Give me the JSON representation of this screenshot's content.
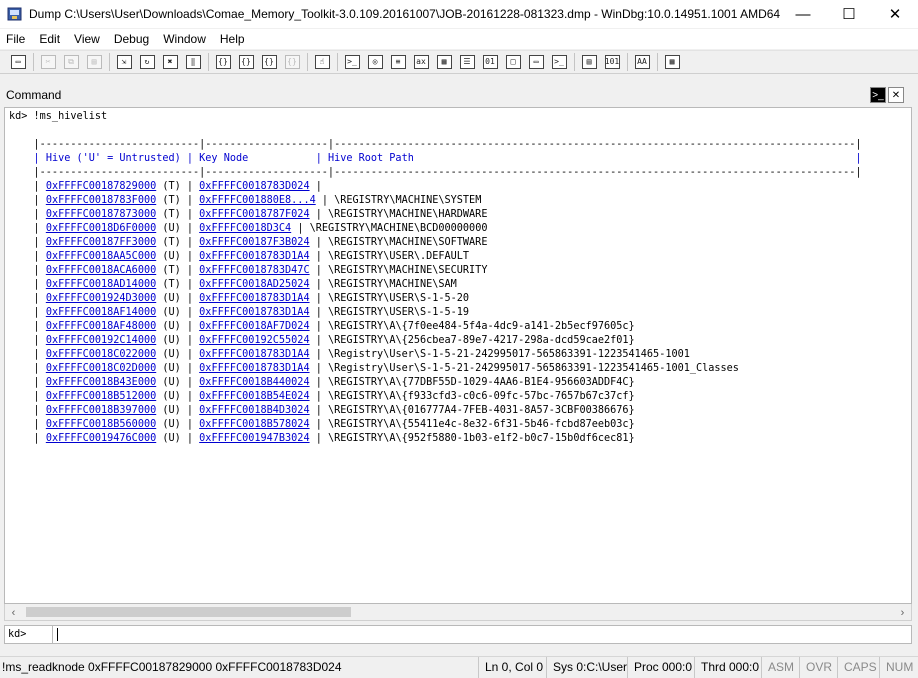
{
  "window": {
    "title": "Dump C:\\Users\\User\\Downloads\\Comae_Memory_Toolkit-3.0.109.20161007\\JOB-20161228-081323.dmp - WinDbg:10.0.14951.1001 AMD64",
    "minimize": "—",
    "maximize": "☐",
    "close": "✕"
  },
  "menu": [
    "File",
    "Edit",
    "View",
    "Debug",
    "Window",
    "Help"
  ],
  "toolbar": {
    "groups": [
      [
        {
          "name": "open-icon",
          "glyph": "▭",
          "enabled": true
        }
      ],
      [
        {
          "name": "cut-icon",
          "glyph": "✂",
          "enabled": false
        },
        {
          "name": "copy-icon",
          "glyph": "⧉",
          "enabled": false
        },
        {
          "name": "paste-icon",
          "glyph": "▤",
          "enabled": false
        }
      ],
      [
        {
          "name": "go-icon",
          "glyph": "⇲",
          "enabled": true
        },
        {
          "name": "restart-icon",
          "glyph": "↻",
          "enabled": true
        },
        {
          "name": "stop-debugging-icon",
          "glyph": "✖",
          "enabled": true
        },
        {
          "name": "break-icon",
          "glyph": "‖",
          "enabled": true
        }
      ],
      [
        {
          "name": "step-into-icon",
          "glyph": "{}",
          "enabled": true
        },
        {
          "name": "step-over-icon",
          "glyph": "{}",
          "enabled": true
        },
        {
          "name": "step-out-icon",
          "glyph": "{}",
          "enabled": true
        },
        {
          "name": "run-to-cursor-icon",
          "glyph": "{}",
          "enabled": false
        }
      ],
      [
        {
          "name": "hand-icon",
          "glyph": "☝",
          "enabled": true
        }
      ],
      [
        {
          "name": "command-window-icon",
          "glyph": ">_",
          "enabled": true
        },
        {
          "name": "watch-window-icon",
          "glyph": "◎",
          "enabled": true
        },
        {
          "name": "locals-window-icon",
          "glyph": "≡",
          "enabled": true
        },
        {
          "name": "registers-window-icon",
          "glyph": "ax",
          "enabled": true
        },
        {
          "name": "memory-window-icon",
          "glyph": "▦",
          "enabled": true
        },
        {
          "name": "call-stack-icon",
          "glyph": "☰",
          "enabled": true
        },
        {
          "name": "disassembly-icon",
          "glyph": "01",
          "enabled": true
        },
        {
          "name": "scratch-pad-icon",
          "glyph": "□",
          "enabled": true
        },
        {
          "name": "processes-threads-icon",
          "glyph": "▭",
          "enabled": true
        },
        {
          "name": "command-browser-icon",
          "glyph": ">_",
          "enabled": true
        }
      ],
      [
        {
          "name": "source-mode-icon",
          "glyph": "▤",
          "enabled": true
        },
        {
          "name": "hex-mode-icon",
          "glyph": "101",
          "enabled": true
        }
      ],
      [
        {
          "name": "font-icon",
          "glyph": "AA",
          "enabled": true
        }
      ],
      [
        {
          "name": "options-icon",
          "glyph": "▦",
          "enabled": true
        }
      ]
    ]
  },
  "command_window": {
    "title": "Command",
    "executed_command": "kd> !ms_hivelist",
    "separator_top": "    |--------------------------|--------------------|-------------------------------------------------------------------------------------|",
    "header": {
      "hive": "| Hive ('U' = Untrusted) ",
      "key_node": "| Key Node           ",
      "path": "| Hive Root Path                                                                        |"
    },
    "separator_mid": "    |--------------------------|--------------------|-------------------------------------------------------------------------------------|",
    "rows": [
      {
        "hive": "0xFFFFC00187829000",
        "flag": "(T)",
        "key": "0xFFFFC0018783D024",
        "path": ""
      },
      {
        "hive": "0xFFFFC0018783F000",
        "flag": "(T)",
        "key": "0xFFFFC001880E8...4",
        "path": "\\REGISTRY\\MACHINE\\SYSTEM"
      },
      {
        "hive": "0xFFFFC00187873000",
        "flag": "(T)",
        "key": "0xFFFFC0018787F024",
        "path": "\\REGISTRY\\MACHINE\\HARDWARE"
      },
      {
        "hive": "0xFFFFC0018D6F0000",
        "flag": "(U)",
        "key": "0xFFFFC0018D3C4",
        "path": "\\REGISTRY\\MACHINE\\BCD00000000"
      },
      {
        "hive": "0xFFFFC00187FF3000",
        "flag": "(T)",
        "key": "0xFFFFC00187F3B024",
        "path": "\\REGISTRY\\MACHINE\\SOFTWARE"
      },
      {
        "hive": "0xFFFFC0018AA5C000",
        "flag": "(U)",
        "key": "0xFFFFC0018783D1A4",
        "path": "\\REGISTRY\\USER\\.DEFAULT"
      },
      {
        "hive": "0xFFFFC0018ACA6000",
        "flag": "(T)",
        "key": "0xFFFFC0018783D47C",
        "path": "\\REGISTRY\\MACHINE\\SECURITY"
      },
      {
        "hive": "0xFFFFC0018AD14000",
        "flag": "(T)",
        "key": "0xFFFFC0018AD25024",
        "path": "\\REGISTRY\\MACHINE\\SAM"
      },
      {
        "hive": "0xFFFFC001924D3000",
        "flag": "(U)",
        "key": "0xFFFFC0018783D1A4",
        "path": "\\REGISTRY\\USER\\S-1-5-20"
      },
      {
        "hive": "0xFFFFC0018AF14000",
        "flag": "(U)",
        "key": "0xFFFFC0018783D1A4",
        "path": "\\REGISTRY\\USER\\S-1-5-19"
      },
      {
        "hive": "0xFFFFC0018AF48000",
        "flag": "(U)",
        "key": "0xFFFFC0018AF7D024",
        "path": "\\REGISTRY\\A\\{7f0ee484-5f4a-4dc9-a141-2b5ecf97605c}"
      },
      {
        "hive": "0xFFFFC00192C14000",
        "flag": "(U)",
        "key": "0xFFFFC00192C55024",
        "path": "\\REGISTRY\\A\\{256cbea7-89e7-4217-298a-dcd59cae2f01}"
      },
      {
        "hive": "0xFFFFC0018C022000",
        "flag": "(U)",
        "key": "0xFFFFC0018783D1A4",
        "path": "\\Registry\\User\\S-1-5-21-242995017-565863391-1223541465-1001"
      },
      {
        "hive": "0xFFFFC0018C02D000",
        "flag": "(U)",
        "key": "0xFFFFC0018783D1A4",
        "path": "\\Registry\\User\\S-1-5-21-242995017-565863391-1223541465-1001_Classes"
      },
      {
        "hive": "0xFFFFC0018B43E000",
        "flag": "(U)",
        "key": "0xFFFFC0018B440024",
        "path": "\\REGISTRY\\A\\{77DBF55D-1029-4AA6-B1E4-956603ADDF4C}"
      },
      {
        "hive": "0xFFFFC0018B512000",
        "flag": "(U)",
        "key": "0xFFFFC0018B54E024",
        "path": "\\REGISTRY\\A\\{f933cfd3-c0c6-09fc-57bc-7657b67c37cf}"
      },
      {
        "hive": "0xFFFFC0018B397000",
        "flag": "(U)",
        "key": "0xFFFFC0018B4D3024",
        "path": "\\REGISTRY\\A\\{016777A4-7FEB-4031-8A57-3CBF00386676}"
      },
      {
        "hive": "0xFFFFC0018B560000",
        "flag": "(U)",
        "key": "0xFFFFC0018B578024",
        "path": "\\REGISTRY\\A\\{55411e4c-8e32-6f31-5b46-fcbd87eeb03c}"
      },
      {
        "hive": "0xFFFFC0019476C000",
        "flag": "(U)",
        "key": "0xFFFFC001947B3024",
        "path": "\\REGISTRY\\A\\{952f5880-1b03-e1f2-b0c7-15b0df6cec81}"
      }
    ],
    "input_prompt": "kd>",
    "input_value": ""
  },
  "statusbar": {
    "message": "!ms_readknode 0xFFFFC00187829000 0xFFFFC0018783D024",
    "position": "Ln 0, Col 0",
    "sys": "Sys 0:C:\\User",
    "proc": "Proc 000:0",
    "thrd": "Thrd 000:0",
    "asm": "ASM",
    "ovr": "OVR",
    "caps": "CAPS",
    "num": "NUM"
  }
}
